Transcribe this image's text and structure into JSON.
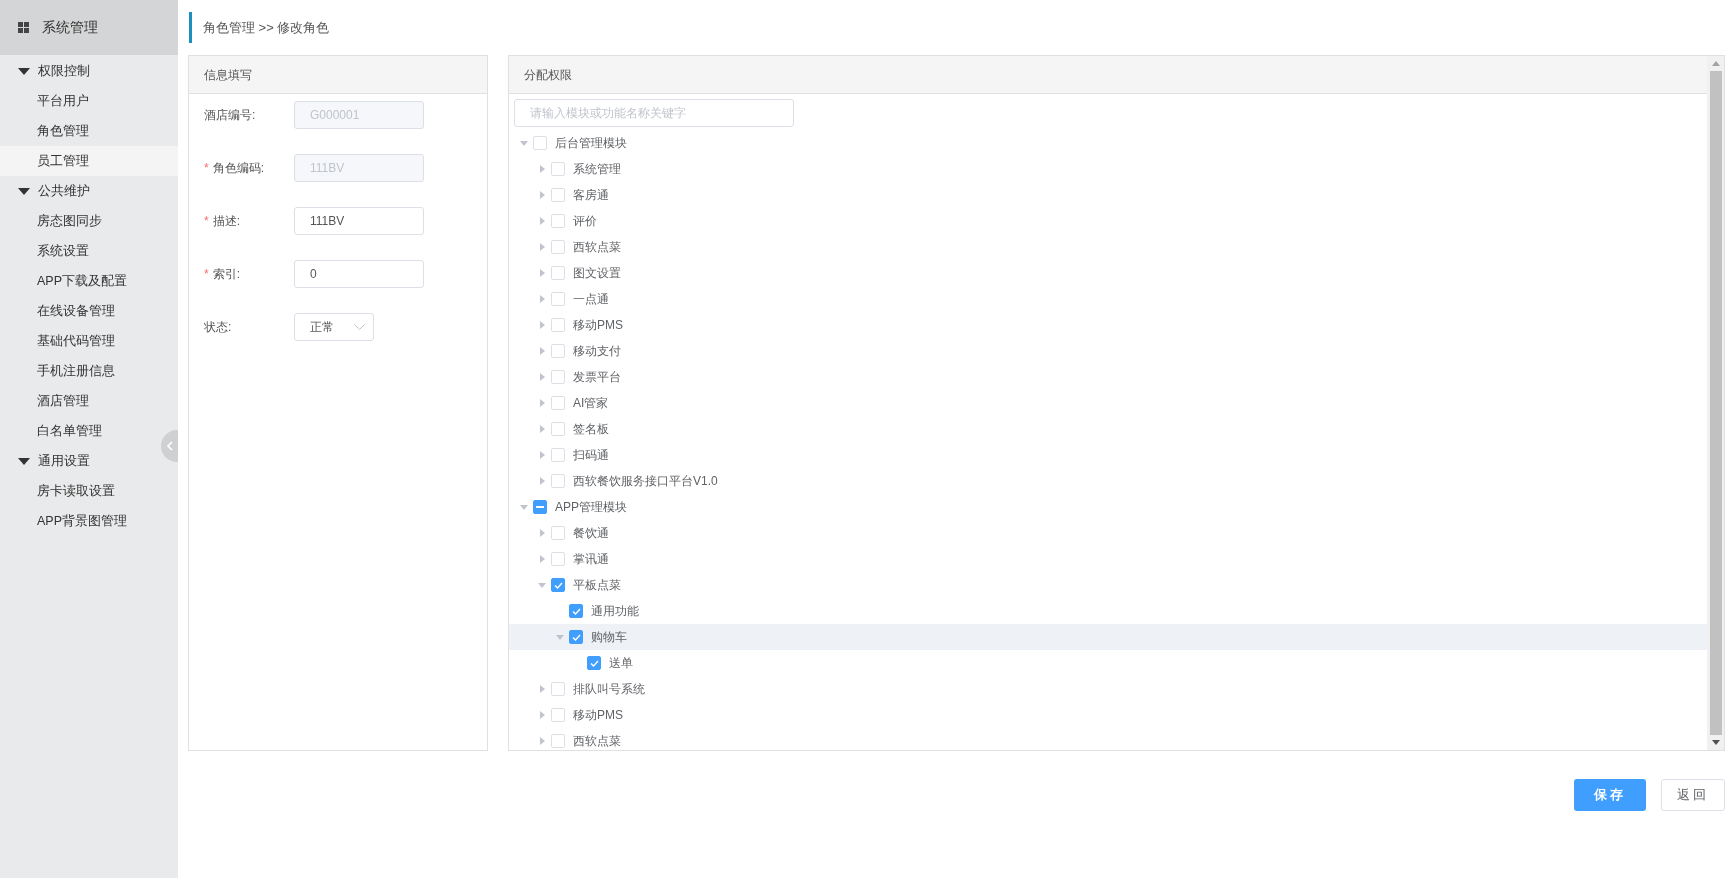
{
  "sidebar": {
    "title": "系统管理",
    "groups": [
      {
        "label": "权限控制",
        "expanded": true,
        "items": [
          {
            "label": "平台用户",
            "selected": false
          },
          {
            "label": "角色管理",
            "selected": false
          },
          {
            "label": "员工管理",
            "selected": true
          }
        ]
      },
      {
        "label": "公共维护",
        "expanded": true,
        "items": [
          {
            "label": "房态图同步",
            "selected": false
          },
          {
            "label": "系统设置",
            "selected": false
          },
          {
            "label": "APP下载及配置",
            "selected": false
          },
          {
            "label": "在线设备管理",
            "selected": false
          },
          {
            "label": "基础代码管理",
            "selected": false
          },
          {
            "label": "手机注册信息",
            "selected": false
          },
          {
            "label": "酒店管理",
            "selected": false
          },
          {
            "label": "白名单管理",
            "selected": false
          }
        ]
      },
      {
        "label": "通用设置",
        "expanded": true,
        "items": [
          {
            "label": "房卡读取设置",
            "selected": false
          },
          {
            "label": "APP背景图管理",
            "selected": false
          }
        ]
      }
    ]
  },
  "breadcrumb": "角色管理 >> 修改角色",
  "info_panel": {
    "title": "信息填写",
    "fields": [
      {
        "label": "酒店编号:",
        "value": "G000001",
        "disabled": true,
        "kind": "input"
      },
      {
        "marker": "*",
        "label": "角色编码:",
        "value": "111BV",
        "disabled": true,
        "kind": "input"
      },
      {
        "marker": "*",
        "label": "描述:",
        "value": "111BV",
        "disabled": false,
        "kind": "input"
      },
      {
        "marker": "*",
        "label": "索引:",
        "value": "0",
        "disabled": false,
        "kind": "input"
      },
      {
        "label": "状态:",
        "value": "正常",
        "kind": "select"
      }
    ]
  },
  "permission_panel": {
    "title": "分配权限",
    "search": {
      "placeholder": "请输入模块或功能名称关键字"
    },
    "tree": [
      {
        "label": "后台管理模块",
        "checked": false,
        "indeterminate": false,
        "expanded": true,
        "selected": false,
        "children": [
          {
            "label": "系统管理",
            "checked": false,
            "indeterminate": false,
            "expanded": false,
            "selected": false
          },
          {
            "label": "客房通",
            "checked": false,
            "indeterminate": false,
            "expanded": false,
            "selected": false
          },
          {
            "label": "评价",
            "checked": false,
            "indeterminate": false,
            "expanded": false,
            "selected": false
          },
          {
            "label": "西软点菜",
            "checked": false,
            "indeterminate": false,
            "expanded": false,
            "selected": false
          },
          {
            "label": "图文设置",
            "checked": false,
            "indeterminate": false,
            "expanded": false,
            "selected": false
          },
          {
            "label": "一点通",
            "checked": false,
            "indeterminate": false,
            "expanded": false,
            "selected": false
          },
          {
            "label": "移动PMS",
            "checked": false,
            "indeterminate": false,
            "expanded": false,
            "selected": false
          },
          {
            "label": "移动支付",
            "checked": false,
            "indeterminate": false,
            "expanded": false,
            "selected": false
          },
          {
            "label": "发票平台",
            "checked": false,
            "indeterminate": false,
            "expanded": false,
            "selected": false
          },
          {
            "label": "AI管家",
            "checked": false,
            "indeterminate": false,
            "expanded": false,
            "selected": false
          },
          {
            "label": "签名板",
            "checked": false,
            "indeterminate": false,
            "expanded": false,
            "selected": false
          },
          {
            "label": "扫码通",
            "checked": false,
            "indeterminate": false,
            "expanded": false,
            "selected": false
          },
          {
            "label": "西软餐饮服务接口平台V1.0",
            "checked": false,
            "indeterminate": false,
            "expanded": false,
            "selected": false
          }
        ]
      },
      {
        "label": "APP管理模块",
        "indeterminate": true,
        "expanded": true,
        "selected": false,
        "children": [
          {
            "label": "餐饮通",
            "checked": false,
            "indeterminate": false,
            "expanded": false,
            "selected": false
          },
          {
            "label": "掌讯通",
            "checked": false,
            "indeterminate": false,
            "expanded": false,
            "selected": false
          },
          {
            "label": "平板点菜",
            "checked": true,
            "indeterminate": false,
            "expanded": true,
            "selected": false,
            "children": [
              {
                "label": "通用功能",
                "checked": true,
                "indeterminate": false,
                "selected": false
              },
              {
                "label": "购物车",
                "checked": true,
                "indeterminate": false,
                "expanded": true,
                "selected": true,
                "children": [
                  {
                    "label": "送单",
                    "checked": true,
                    "indeterminate": false,
                    "selected": false
                  }
                ]
              }
            ]
          },
          {
            "label": "排队叫号系统",
            "checked": false,
            "indeterminate": false,
            "expanded": false,
            "selected": false
          },
          {
            "label": "移动PMS",
            "checked": false,
            "indeterminate": false,
            "expanded": false,
            "selected": false
          },
          {
            "label": "西软点菜",
            "checked": false,
            "indeterminate": false,
            "expanded": false,
            "selected": false
          }
        ]
      }
    ]
  },
  "buttons": [
    {
      "label": "保存",
      "kind": "primary"
    },
    {
      "label": "返回",
      "kind": "default"
    }
  ]
}
